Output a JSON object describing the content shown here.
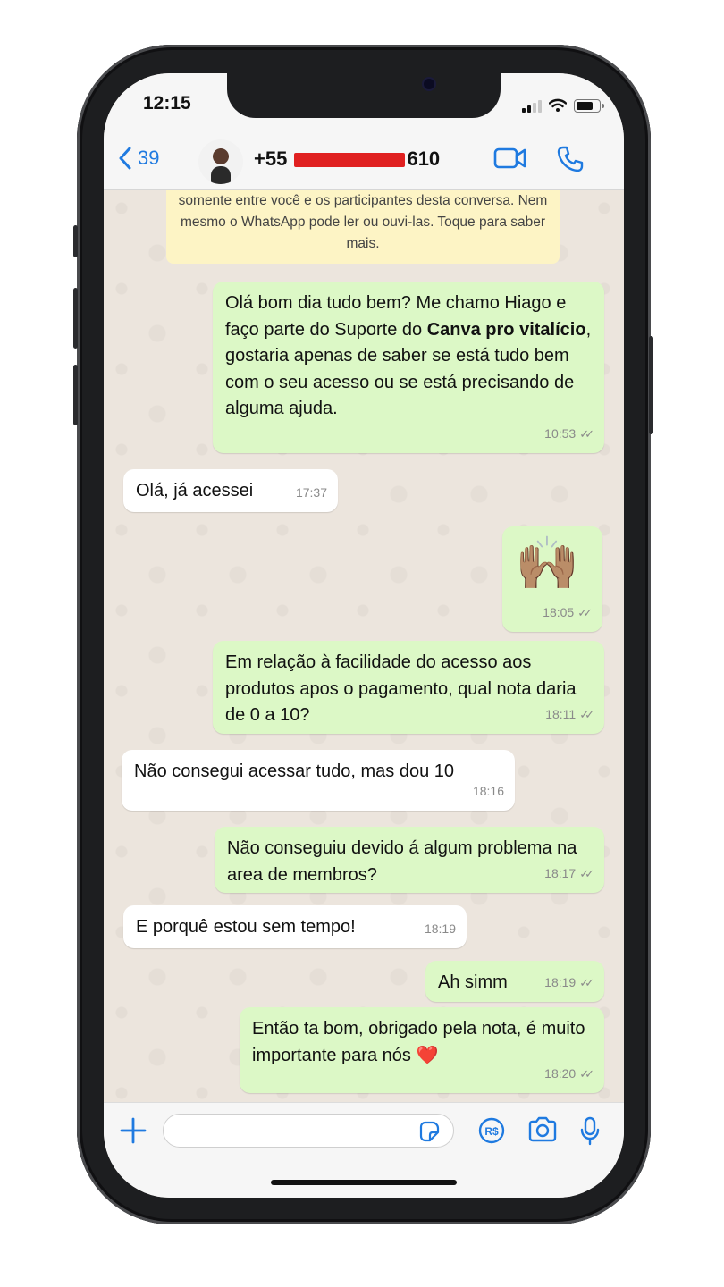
{
  "status": {
    "time": "12:15"
  },
  "header": {
    "back_count": "39",
    "contact_prefix": "+55",
    "contact_suffix": "610"
  },
  "notice": {
    "text": "somente entre você e os participantes desta conversa. Nem mesmo o WhatsApp pode ler ou ouvi-las. Toque para saber mais."
  },
  "messages": [
    {
      "dir": "out",
      "text_pre": "Olá bom dia tudo bem? Me chamo Hiago e faço parte do Suporte do ",
      "text_bold": "Canva pro vitalício",
      "text_post": ", gostaria apenas de saber se está tudo bem com o seu acesso ou se está precisando de alguma ajuda.",
      "time": "10:53"
    },
    {
      "dir": "in",
      "text": "Olá,  já acessei",
      "time": "17:37"
    },
    {
      "dir": "out",
      "emoji": "🙌🏽",
      "time": "18:05"
    },
    {
      "dir": "out",
      "text": "Em relação à facilidade do acesso aos produtos apos o pagamento, qual nota daria de 0 a 10?",
      "time": "18:11"
    },
    {
      "dir": "in",
      "text": "Não consegui acessar tudo, mas dou 10",
      "time": "18:16"
    },
    {
      "dir": "out",
      "text": "Não conseguiu devido á algum problema na area de membros?",
      "time": "18:17"
    },
    {
      "dir": "in",
      "text": "E porquê estou sem tempo!",
      "time": "18:19"
    },
    {
      "dir": "out",
      "text": "Ah simm",
      "time": "18:19"
    },
    {
      "dir": "out",
      "text": "Então ta bom, obrigado pela nota, é muito importante para nós ❤️",
      "time": "18:20"
    }
  ],
  "colors": {
    "outgoing": "#dcf8c6",
    "incoming": "#ffffff",
    "accent": "#1f7ae0",
    "notice": "#fdf4c5"
  },
  "icons": [
    "back-chevron-icon",
    "video-call-icon",
    "phone-call-icon",
    "plus-icon",
    "sticker-icon",
    "pix-icon",
    "camera-icon",
    "microphone-icon"
  ]
}
